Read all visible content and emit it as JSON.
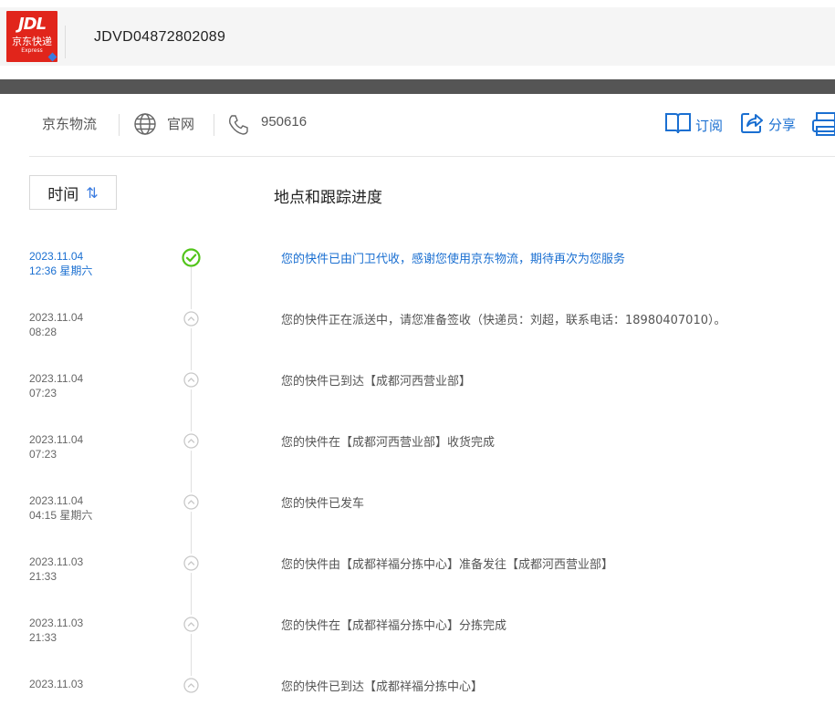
{
  "header": {
    "logo": {
      "brand": "JDL",
      "name_cn": "京东快递",
      "name_en": "Express"
    },
    "tracking_number": "JDVD04872802089"
  },
  "info": {
    "carrier": "京东物流",
    "site_label": "官网",
    "phone": "950616",
    "subscribe_label": "订阅",
    "share_label": "分享"
  },
  "columns": {
    "time_label": "时间",
    "sort_icon": "⇅",
    "progress_label": "地点和跟踪进度"
  },
  "colors": {
    "accent": "#1a6fd1",
    "brand_red": "#e1251b",
    "current_check": "#52c41a"
  },
  "events": [
    {
      "date": "2023.11.04",
      "time": "12:36",
      "weekday": "星期六",
      "text": "您的快件已由门卫代收，感谢您使用京东物流，期待再次为您服务",
      "current": true
    },
    {
      "date": "2023.11.04",
      "time": "08:28",
      "weekday": "",
      "text": "您的快件正在派送中，请您准备签收（快递员：刘超，联系电话：18980407010）。",
      "current": false
    },
    {
      "date": "2023.11.04",
      "time": "07:23",
      "weekday": "",
      "text": "您的快件已到达【成都河西营业部】",
      "current": false
    },
    {
      "date": "2023.11.04",
      "time": "07:23",
      "weekday": "",
      "text": "您的快件在【成都河西营业部】收货完成",
      "current": false
    },
    {
      "date": "2023.11.04",
      "time": "04:15",
      "weekday": "星期六",
      "text": "您的快件已发车",
      "current": false
    },
    {
      "date": "2023.11.03",
      "time": "21:33",
      "weekday": "",
      "text": "您的快件由【成都祥福分拣中心】准备发往【成都河西营业部】",
      "current": false
    },
    {
      "date": "2023.11.03",
      "time": "21:33",
      "weekday": "",
      "text": "您的快件在【成都祥福分拣中心】分拣完成",
      "current": false
    },
    {
      "date": "2023.11.03",
      "time": "",
      "weekday": "",
      "text": "您的快件已到达【成都祥福分拣中心】",
      "current": false
    }
  ]
}
